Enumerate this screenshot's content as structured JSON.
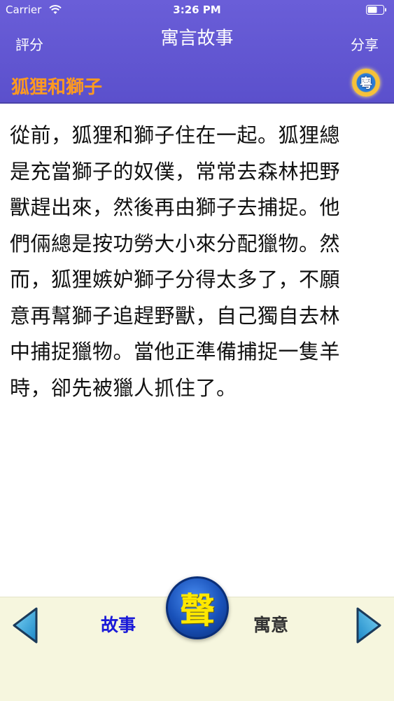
{
  "status_bar": {
    "carrier": "Carrier",
    "time": "3:26 PM"
  },
  "nav": {
    "left_label": "評分",
    "title": "寓言故事",
    "right_label": "分享"
  },
  "story": {
    "title": "狐狸和獅子",
    "lang_badge": "粵",
    "lines": [
      "從前，狐狸和獅子住在一起。狐狸總",
      "是充當獅子的奴僕，常常去森林把野",
      "獸趕出來，然後再由獅子去捕捉。他",
      "們倆總是按功勞大小來分配獵物。然",
      "而，狐狸嫉妒獅子分得太多了，不願",
      "意再幫獅子追趕野獸，自己獨自去林",
      "中捕捉獵物。當他正準備捕捉一隻羊",
      "時，卻先被獵人抓住了。"
    ]
  },
  "bottom": {
    "tab_story": "故事",
    "sound_label": "聲",
    "tab_moral": "寓意"
  },
  "colors": {
    "header": "#5b50cc",
    "title_orange": "#ff9a1f",
    "tab_active": "#1a1ad8",
    "arrow": "#2aa8e0",
    "bottom_bg": "#f6f6de"
  },
  "icons": {
    "wifi": "wifi-icon",
    "battery": "battery-icon",
    "prev": "arrow-left-icon",
    "next": "arrow-right-icon"
  }
}
